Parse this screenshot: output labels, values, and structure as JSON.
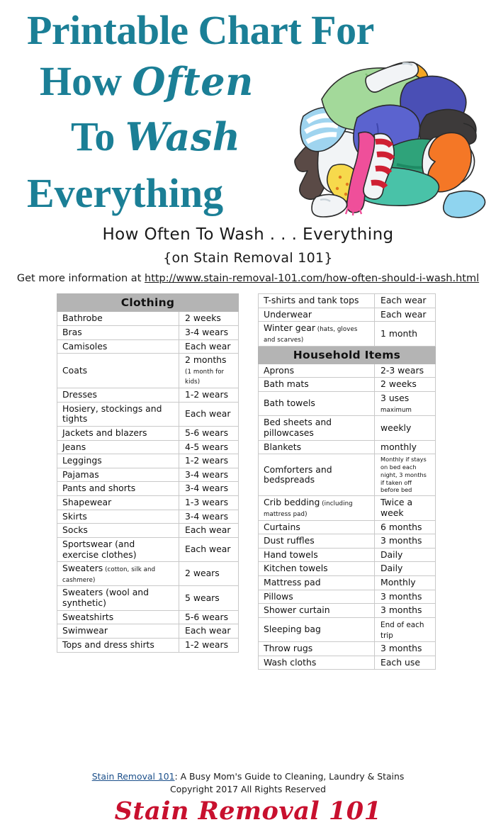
{
  "title": {
    "line1": "Printable Chart For",
    "line2_plain": "How ",
    "line2_script": "Often",
    "line3_plain": "To ",
    "line3_script": "Wash",
    "line4": "Everything"
  },
  "subtitle": {
    "line1": "How Often To Wash . . . Everything",
    "line2": "{on Stain Removal 101}"
  },
  "url_line": {
    "label": "Get more information at ",
    "url": "http://www.stain-removal-101.com/how-often-should-i-wash.html"
  },
  "colors": {
    "title_teal": "#1b7f96",
    "section_header_gray": "#b4b4b4",
    "table_border": "#c9c9c9",
    "logo_red": "#c8102e",
    "link_blue": "#1b4f8a"
  },
  "left_table": {
    "section": "Clothing",
    "rows": [
      {
        "item": "Bathrobe",
        "value": "2 weeks"
      },
      {
        "item": "Bras",
        "value": "3-4 wears"
      },
      {
        "item": "Camisoles",
        "value": "Each wear"
      },
      {
        "item": "Coats",
        "value": "2 months",
        "value_note": "(1 month for kids)"
      },
      {
        "item": "Dresses",
        "value": "1-2 wears"
      },
      {
        "item": "Hosiery, stockings and tights",
        "value": "Each wear"
      },
      {
        "item": "Jackets and blazers",
        "value": "5-6 wears"
      },
      {
        "item": "Jeans",
        "value": "4-5 wears"
      },
      {
        "item": "Leggings",
        "value": "1-2 wears"
      },
      {
        "item": "Pajamas",
        "value": "3-4 wears"
      },
      {
        "item": "Pants and shorts",
        "value": "3-4 wears"
      },
      {
        "item": "Shapewear",
        "value": "1-3 wears"
      },
      {
        "item": "Skirts",
        "value": "3-4 wears"
      },
      {
        "item": "Socks",
        "value": "Each wear"
      },
      {
        "item": "Sportswear (and exercise clothes)",
        "value": "Each wear"
      },
      {
        "item": "Sweaters",
        "item_note": "(cotton, silk and cashmere)",
        "value": "2 wears"
      },
      {
        "item": "Sweaters (wool and synthetic)",
        "value": "5 wears"
      },
      {
        "item": "Sweatshirts",
        "value": "5-6 wears"
      },
      {
        "item": "Swimwear",
        "value": "Each wear"
      },
      {
        "item": "Tops and dress shirts",
        "value": "1-2 wears"
      }
    ]
  },
  "right_table": {
    "clothing_continued": [
      {
        "item": "T-shirts and tank tops",
        "value": "Each wear"
      },
      {
        "item": "Underwear",
        "value": "Each wear"
      },
      {
        "item": "Winter gear",
        "item_note": "(hats, gloves and scarves)",
        "value": "1 month"
      }
    ],
    "section": "Household Items",
    "rows": [
      {
        "item": "Aprons",
        "value": "2-3 wears"
      },
      {
        "item": "Bath mats",
        "value": "2 weeks"
      },
      {
        "item": "Bath towels",
        "value": "3 uses",
        "value_note": "maximum"
      },
      {
        "item": "Bed sheets and pillowcases",
        "value": "weekly"
      },
      {
        "item": "Blankets",
        "value": "monthly"
      },
      {
        "item": "Comforters and bedspreads",
        "value_block": "Monthly if stays on bed each night, 3 months if taken off before bed"
      },
      {
        "item": "Crib bedding",
        "item_note": "(including mattress pad)",
        "value": "Twice a week"
      },
      {
        "item": "Curtains",
        "value": "6 months"
      },
      {
        "item": "Dust ruffles",
        "value": "3 months"
      },
      {
        "item": "Hand towels",
        "value": "Daily"
      },
      {
        "item": "Kitchen towels",
        "value": "Daily"
      },
      {
        "item": "Mattress pad",
        "value": "Monthly"
      },
      {
        "item": "Pillows",
        "value": "3 months"
      },
      {
        "item": "Shower curtain",
        "value": "3 months"
      },
      {
        "item": "Sleeping bag",
        "value": "End of each trip",
        "value_small": true
      },
      {
        "item": "Throw rugs",
        "value": "3 months"
      },
      {
        "item": "Wash cloths",
        "value": "Each use"
      }
    ]
  },
  "footer": {
    "site_name": "Stain Removal 101",
    "tagline": ": A Busy Mom's Guide to Cleaning, Laundry & Stains",
    "copyright": "Copyright 2017 All Rights Reserved",
    "logo": "Stain Removal 101"
  }
}
